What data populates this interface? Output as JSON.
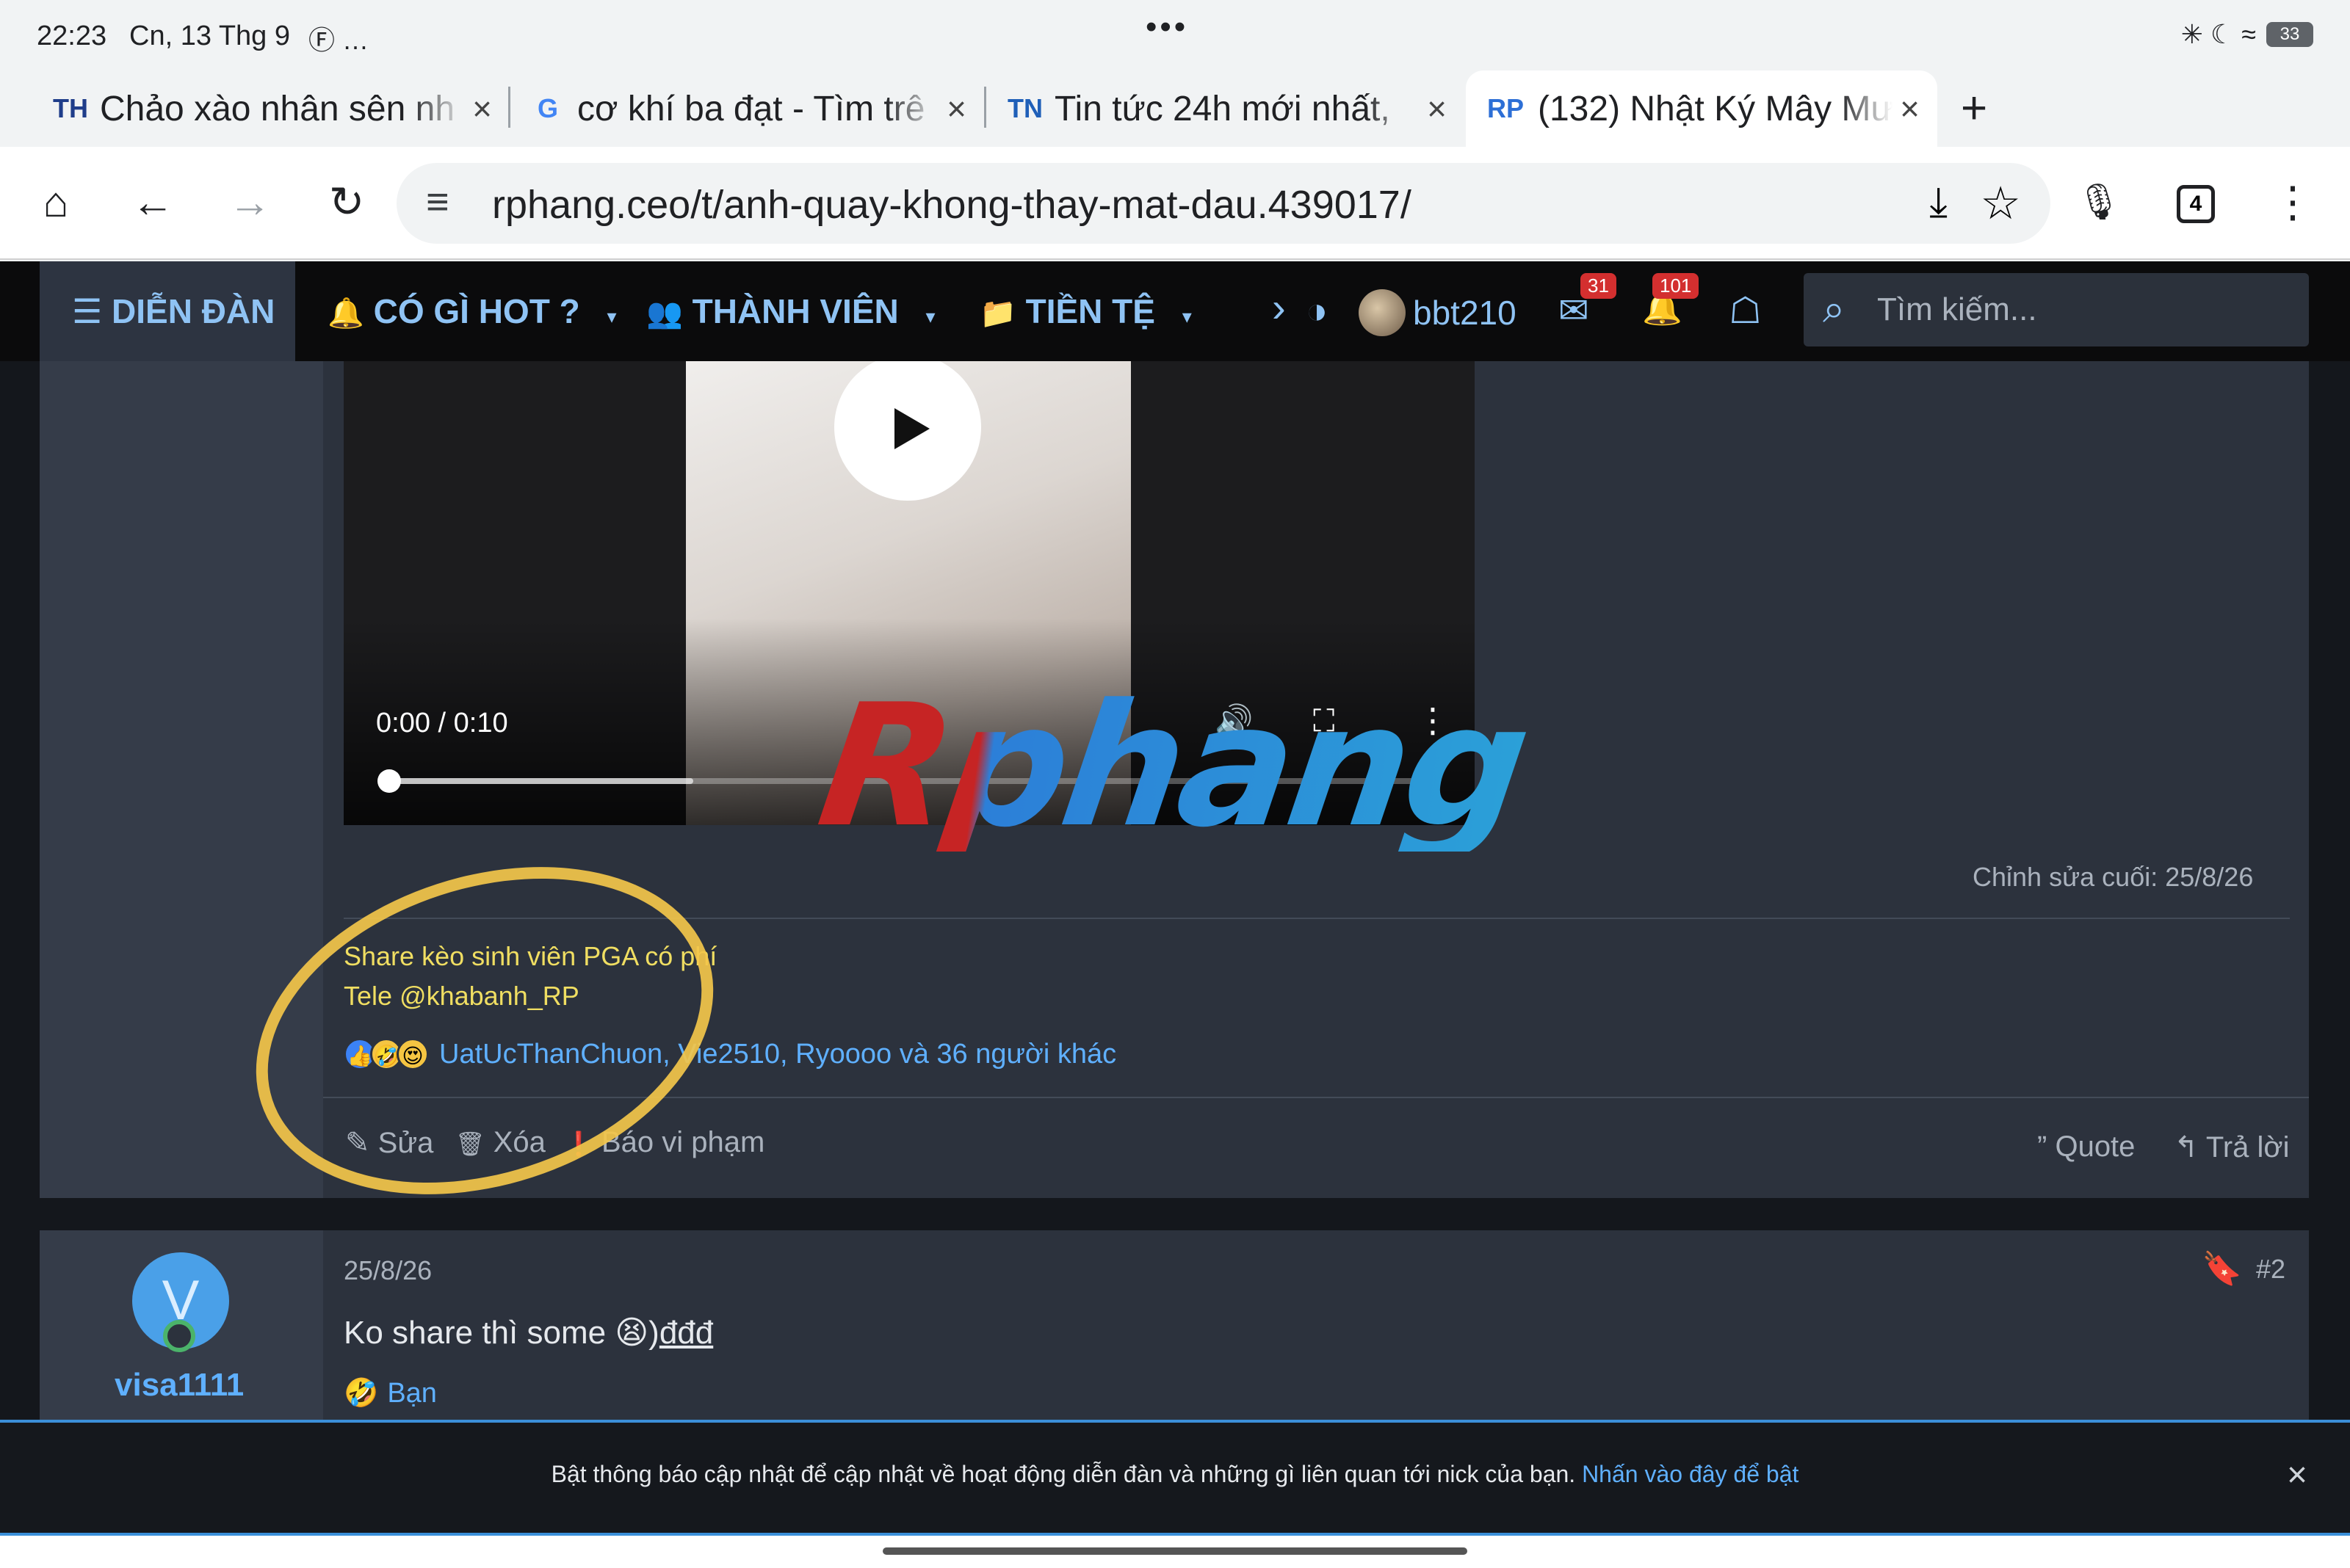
{
  "status_bar": {
    "time": "22:23",
    "date": "Cn, 13 Thg 9",
    "extra_icons": "Ⓕ …",
    "dots": "•••",
    "system_icons": "✳ ☾ ≈",
    "battery": "33"
  },
  "tabs": [
    {
      "favicon": "TH",
      "title": "Chảo xào nhân sên nh",
      "active": false
    },
    {
      "favicon": "G",
      "title": "cơ khí ba đạt - Tìm trê",
      "active": false
    },
    {
      "favicon": "TN",
      "title": "Tin tức 24h mới nhất,",
      "active": false
    },
    {
      "favicon": "RP",
      "title": "(132) Nhật Ký Mây Mư",
      "active": true
    }
  ],
  "tab_close": "×",
  "new_tab": "+",
  "toolbar": {
    "home": "⌂",
    "back": "←",
    "forward": "→",
    "reload": "↻",
    "url": "rphang.ceo/t/anh-quay-khong-thay-mat-dau.439017/",
    "tune": "≡",
    "download": "⤓",
    "star": "☆",
    "mic": "🎙",
    "tab_count": "4",
    "menu": "⋮"
  },
  "forum_nav": {
    "items": [
      {
        "icon": "☰",
        "label": "DIỄN ĐÀN",
        "active": true
      },
      {
        "icon": "🔔",
        "label": "CÓ GÌ HOT ?",
        "caret": "▾"
      },
      {
        "icon": "👥",
        "label": "THÀNH VIÊN",
        "caret": "▾"
      },
      {
        "icon": "📁",
        "label": "TIỀN TỆ",
        "caret": "▾"
      }
    ],
    "more": "›",
    "theme_icon": "◑",
    "username": "bbt210",
    "messages_badge": "31",
    "alerts_badge": "101",
    "mail_icon": "✉",
    "bell_icon": "🔔",
    "store_icon": "☖",
    "search_icon": "⌕",
    "search_placeholder": "Tìm kiếm..."
  },
  "post1": {
    "video": {
      "time": "0:00 / 0:10",
      "volume_icon": "🔊",
      "fullscreen_icon": "⛶",
      "more_icon": "⋮",
      "progress": 0.0
    },
    "watermark": "Rphang",
    "last_edited": "Chỉnh sửa cuối: 25/8/26",
    "signature_line1": "Share kèo sinh viên PGA có phí",
    "signature_line2": "Tele @khabanh_RP",
    "reaction_emojis": [
      "👍",
      "🤣",
      "😍"
    ],
    "reaction_names": "UatUcThanChuon, Vie2510, Ryoooo và 36 người khác",
    "actions": {
      "edit": "Sửa",
      "delete": "Xóa",
      "report": "Báo vi phạm",
      "quote": "Quote",
      "reply": "Trả lời"
    },
    "action_icons": {
      "edit": "✎",
      "delete": "🗑",
      "report": "❗",
      "quote": "”",
      "reply": "↰"
    }
  },
  "post2": {
    "avatar_letter": "V",
    "username": "visa1111",
    "date": "25/8/26",
    "bookmark_icon": "🔖",
    "post_number": "#2",
    "body_text": "Ko share thì some ",
    "body_emoji": "😫",
    "body_tail": ")",
    "body_underlined": "đđđ",
    "reaction_emoji": "🤣",
    "reaction_name": "Bạn"
  },
  "notice": {
    "message": "Bật thông báo cập nhật để cập nhật về hoạt động diễn đàn và những gì liên quan tới nick của bạn.",
    "link": "Nhấn vào đây để bật",
    "close": "×"
  }
}
